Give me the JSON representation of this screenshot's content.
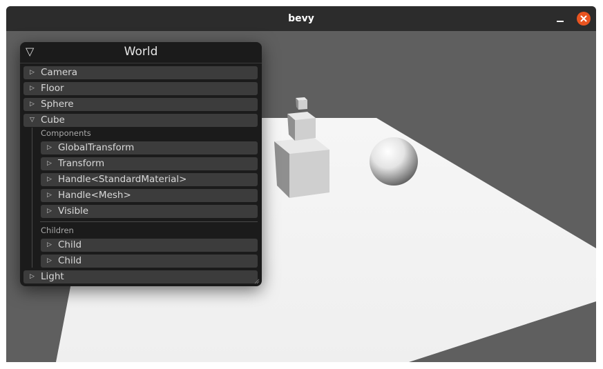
{
  "window": {
    "title": "bevy",
    "close_color": "#e95420"
  },
  "inspector": {
    "title": "World",
    "header_icon": "triangle-down-icon",
    "entities": {
      "camera": "Camera",
      "floor": "Floor",
      "sphere": "Sphere",
      "cube": "Cube",
      "light": "Light"
    },
    "cube": {
      "components_label": "Components",
      "components": [
        "GlobalTransform",
        "Transform",
        "Handle<StandardMaterial>",
        "Handle<Mesh>",
        "Visible"
      ],
      "children_label": "Children",
      "children": [
        "Child",
        "Child"
      ]
    },
    "collapsed_icon": "▷",
    "expanded_icon": "▽"
  }
}
